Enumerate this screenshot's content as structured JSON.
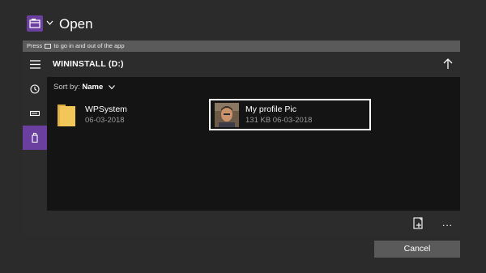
{
  "header": {
    "app_icon": "file-explorer-icon",
    "title": "Open"
  },
  "hint": {
    "prefix": "Press",
    "icon": "view-keyboard-icon",
    "suffix": "to go in and out of the app"
  },
  "toolbar": {
    "menu_icon": "hamburger-icon",
    "location": "WININSTALL (D:)",
    "up_icon": "up-arrow-icon"
  },
  "nav": {
    "items": [
      {
        "icon": "clock-icon",
        "label": "Recent",
        "selected": false
      },
      {
        "icon": "drive-icon",
        "label": "This device",
        "selected": false
      },
      {
        "icon": "usb-drive-icon",
        "label": "WININSTALL (D:)",
        "selected": true
      }
    ]
  },
  "sort": {
    "label": "Sort by:",
    "value": "Name"
  },
  "files": [
    {
      "name": "WPSystem",
      "meta": "06-03-2018",
      "type": "folder",
      "icon": "folder-icon"
    },
    {
      "name": "My profile Pic",
      "meta": "131 KB 06-03-2018",
      "type": "image",
      "icon": "photo-thumbnail",
      "selected": true
    }
  ],
  "bottom": {
    "new_folder_icon": "new-folder-icon",
    "more_icon": "more-icon",
    "more_text": "..."
  },
  "actions": {
    "cancel_label": "Cancel"
  },
  "colors": {
    "background": "#2b2b2b",
    "panel": "#141414",
    "bar": "#2c2c2c",
    "accent": "#6b3fa0",
    "button": "#5a5a5a"
  }
}
